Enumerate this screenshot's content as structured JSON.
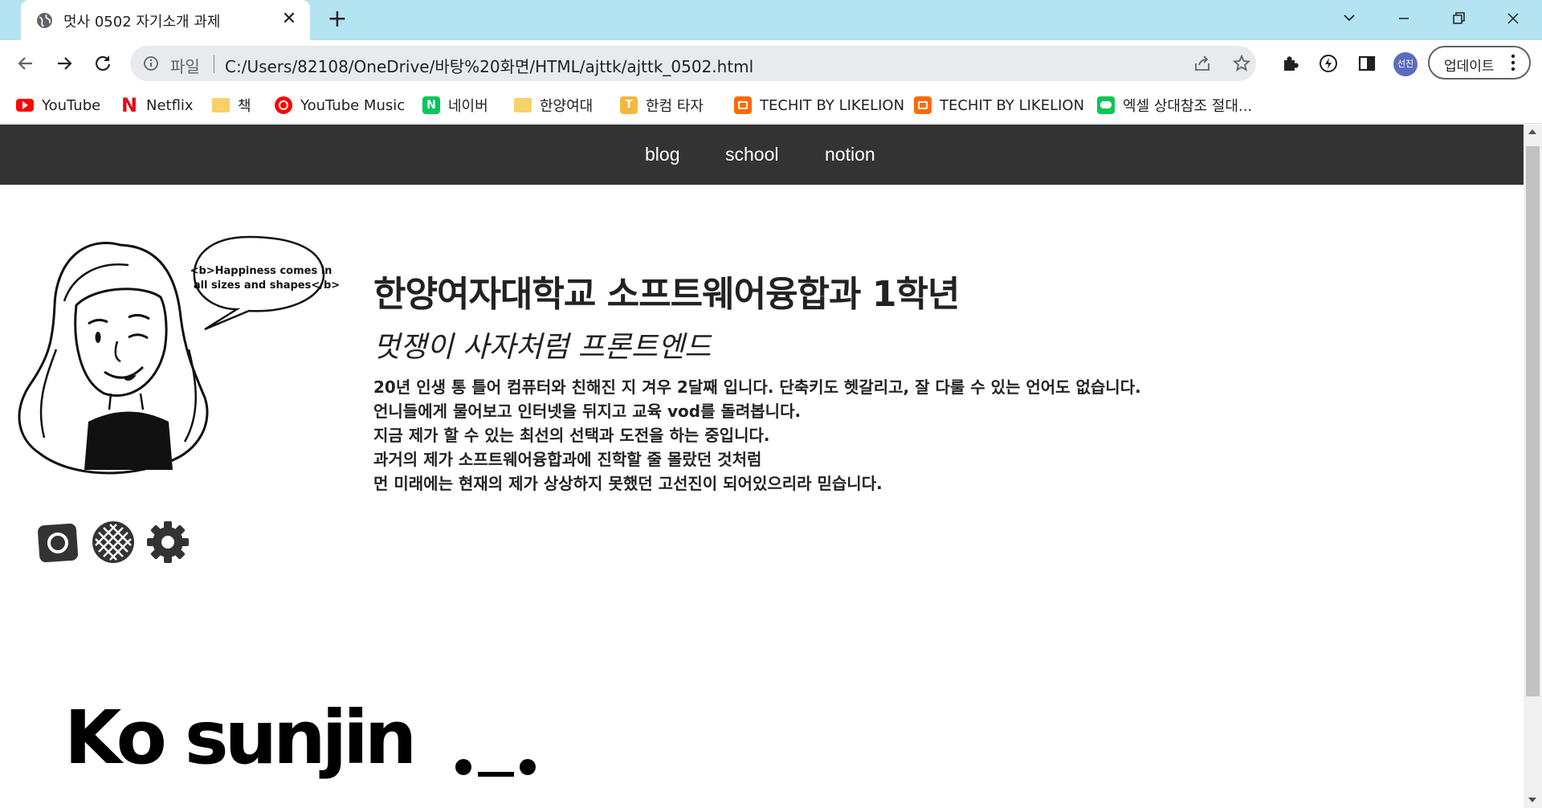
{
  "browser": {
    "tab_title": "멋사 0502 자기소개 과제",
    "tab_close": "✕",
    "new_tab": "+",
    "file_label": "파일",
    "url": "C:/Users/82108/OneDrive/바탕%20화면/HTML/ajttk/ajttk_0502.html",
    "profile_initials": "선진",
    "update_label": "업데이트",
    "bookmarks": [
      {
        "label": "YouTube",
        "icon": "youtube-icon"
      },
      {
        "label": "Netflix",
        "icon": "netflix-icon"
      },
      {
        "label": "책",
        "icon": "folder-icon"
      },
      {
        "label": "YouTube Music",
        "icon": "youtube-music-icon"
      },
      {
        "label": "네이버",
        "icon": "naver-icon"
      },
      {
        "label": "한양여대",
        "icon": "folder-icon"
      },
      {
        "label": "한컴 타자",
        "icon": "hancom-icon"
      },
      {
        "label": "TECHIT BY LIKELION",
        "icon": "techit-icon"
      },
      {
        "label": "TECHIT BY LIKELION",
        "icon": "techit-icon"
      },
      {
        "label": "엑셀 상대참조 절대...",
        "icon": "line-icon"
      }
    ]
  },
  "site": {
    "nav": [
      "blog",
      "school",
      "notion"
    ],
    "speech_bubble": [
      "<b>Happiness comes in",
      "all sizes and shapes</b>"
    ],
    "headline": "한양여자대학교 소프트웨어융합과 1학년",
    "subline": "멋쟁이 사자처럼 프론트엔드",
    "bio_lines": [
      "20년 인생 통 틀어 컴퓨터와 친해진 지 겨우 2달째 입니다. 단축키도 헷갈리고, 잘 다룰 수 있는 언어도 없습니다.",
      "언니들에게 물어보고 인터넷을 뒤지고 교육 vod를 돌려봅니다.",
      "지금 제가 할 수 있는 최선의 선택과 도전을 하는 중입니다.",
      "과거의 제가 소프트웨어융합과에 진학할 줄 몰랐던 것처럼",
      "먼 미래에는 현재의 제가 상상하지 못했던 고선진이 되어있으리라 믿습니다."
    ],
    "social_icons": [
      "instagram-icon",
      "dribbble-icon",
      "settings-gear-icon"
    ],
    "big_name": "Ko sunjin"
  },
  "colors": {
    "tabstrip": "#b4e3f1",
    "nav_bg": "#333333",
    "nav_text": "#ffffff",
    "text": "#222222"
  }
}
